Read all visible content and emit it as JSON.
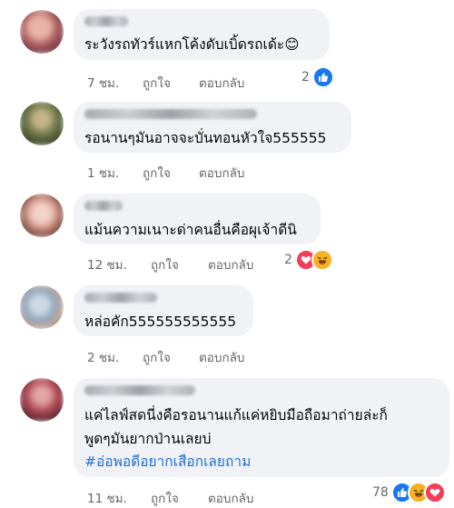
{
  "labels": {
    "like": "ถูกใจ",
    "reply": "ตอบกลับ"
  },
  "colors": {
    "like_blue": "#1877f2",
    "love_red": "#f33e58",
    "haha_yellow": "#f7b125",
    "bubble": "#f0f2f5",
    "meta": "#65676b",
    "hashtag": "#216fdb"
  },
  "comments": [
    {
      "text": "ระวังรถทัวร์แหกโค้งดับเบิ้ดรถเด้ะ",
      "emoji": "😊",
      "time": "7 ชม.",
      "reaction_count": "2",
      "reactions": [
        "like-icon"
      ]
    },
    {
      "text": "รอนานๆมันอาจจะบั่นทอนหัวใจ555555",
      "time": "1 ชม."
    },
    {
      "text": "แม้นความเนาะด่าคนอื่นคือผุเจ้าดีนิ",
      "time": "12 ชม.",
      "reaction_count": "2",
      "reactions": [
        "love-icon",
        "haha-icon"
      ]
    },
    {
      "text": "หล่อคัก555555555555",
      "time": "2 ชม."
    },
    {
      "lines": [
        "แค่ไลฟ์สดนี่งคือรอนานแก้แค่หยิบมือถือมาถ่ายล่ะก็",
        "พูดๆมันยากป่านเลยบ่"
      ],
      "hashtag": "#อ่อพอดีอยากเสือกเลยถาม",
      "time": "11 ชม.",
      "reaction_count": "78",
      "reactions": [
        "like-icon",
        "haha-icon",
        "love-icon"
      ]
    }
  ]
}
